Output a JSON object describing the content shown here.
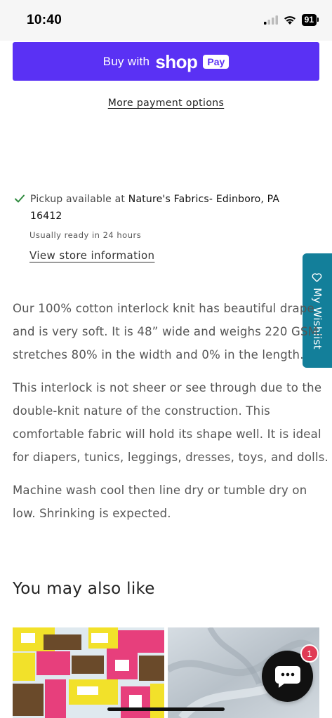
{
  "status_bar": {
    "time": "10:40",
    "battery": "91"
  },
  "checkout": {
    "buy_label": "Buy with",
    "shop_logo": "shop",
    "pay_badge": "Pay",
    "more_payment": "More payment options",
    "brand_color": "#5a31f4"
  },
  "pickup": {
    "prefix": "Pickup available at ",
    "store": "Nature's Fabrics- Edinboro, PA 16412",
    "ready": "Usually ready in 24 hours",
    "view_store": "View store information"
  },
  "wishlist": {
    "label": "My Wishlist",
    "color": "#137f9a"
  },
  "description": {
    "p1": [
      "Our 100% cotton interlock knit has beautiful drape",
      "and is very soft. It is 48” wide and weighs 220 GSM.",
      "stretches 80% in the width and 0% in the length."
    ],
    "p2": [
      "This interlock is not sheer or see through due to the",
      "double-knit nature of the construction. This",
      "comfortable fabric will hold its shape well. It is ideal",
      "for diapers, tunics, leggings, dresses, toys, and dolls."
    ],
    "p3": [
      "Machine wash cool then line dry or tumble dry on",
      "low. Shrinking is expected."
    ]
  },
  "recommendations": {
    "heading": "You may also like"
  },
  "chat": {
    "badge_count": "1",
    "icon": "chat-bubble-icon"
  }
}
